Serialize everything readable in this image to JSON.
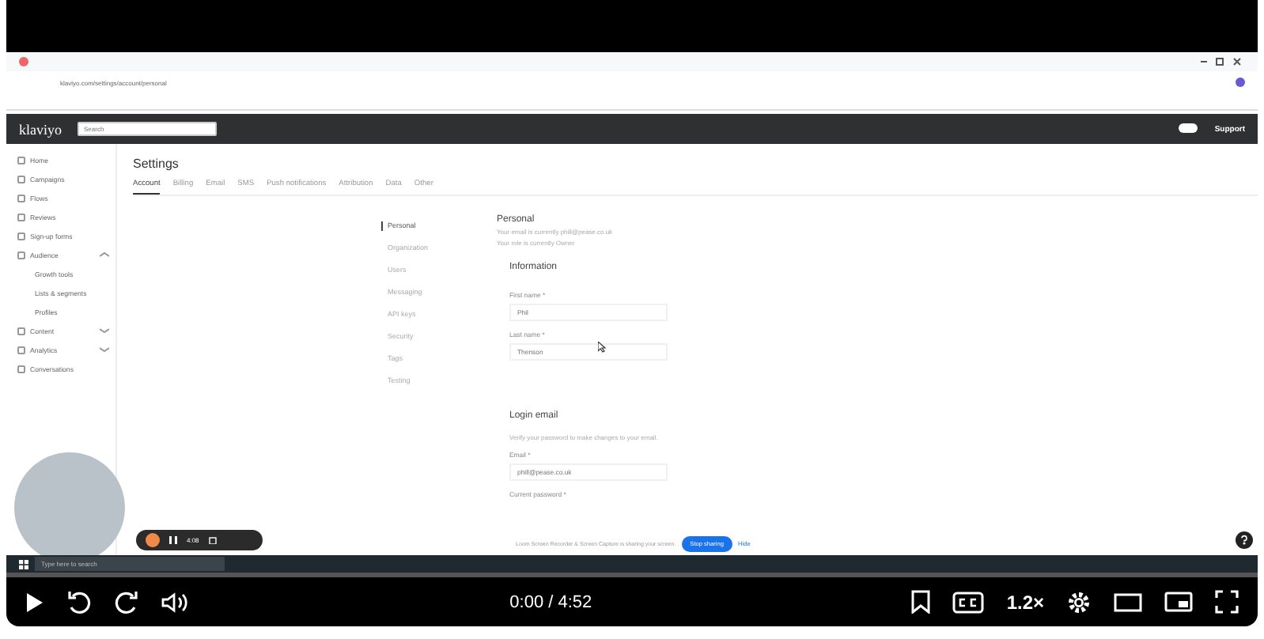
{
  "browser": {
    "url": "klaviyo.com/settings/account/personal"
  },
  "app": {
    "logo": "klaviyo",
    "search_placeholder": "Search",
    "support": "Support"
  },
  "nav": [
    {
      "label": "Home",
      "kind": "link"
    },
    {
      "label": "Campaigns",
      "kind": "link"
    },
    {
      "label": "Flows",
      "kind": "link"
    },
    {
      "label": "Reviews",
      "kind": "link"
    },
    {
      "label": "Sign-up forms",
      "kind": "link"
    },
    {
      "label": "Audience",
      "kind": "group",
      "expanded": true,
      "children": [
        {
          "label": "Growth tools"
        },
        {
          "label": "Lists & segments"
        },
        {
          "label": "Profiles"
        }
      ]
    },
    {
      "label": "Content",
      "kind": "group",
      "expanded": false
    },
    {
      "label": "Analytics",
      "kind": "group",
      "expanded": false
    },
    {
      "label": "Conversations",
      "kind": "link"
    }
  ],
  "page_title": "Settings",
  "tabs": [
    {
      "label": "Account",
      "selected": true
    },
    {
      "label": "Billing",
      "selected": false
    },
    {
      "label": "Email",
      "selected": false
    },
    {
      "label": "SMS",
      "selected": false
    },
    {
      "label": "Push notifications",
      "selected": false
    },
    {
      "label": "Attribution",
      "selected": false
    },
    {
      "label": "Data",
      "selected": false
    },
    {
      "label": "Other",
      "selected": false
    }
  ],
  "subnav": [
    {
      "label": "Personal",
      "selected": true
    },
    {
      "label": "Organization",
      "selected": false
    },
    {
      "label": "Users",
      "selected": false
    },
    {
      "label": "Messaging",
      "selected": false
    },
    {
      "label": "API keys",
      "selected": false
    },
    {
      "label": "Security",
      "selected": false
    },
    {
      "label": "Tags",
      "selected": false
    },
    {
      "label": "Testing",
      "selected": false
    }
  ],
  "personal": {
    "heading": "Personal",
    "lines": [
      "Your email is currently phill@pease.co.uk",
      "Your role is currently Owner"
    ]
  },
  "information": {
    "heading": "Information",
    "fields": [
      {
        "label": "First name *",
        "value": "Phil"
      },
      {
        "label": "Last name *",
        "value": "Thenson"
      }
    ]
  },
  "login_email": {
    "heading": "Login email",
    "hint": "Verify your password to make changes to your email.",
    "fields": [
      {
        "label": "Email *",
        "value": "phill@pease.co.uk"
      }
    ],
    "password_label": "Current password *"
  },
  "share_bar": {
    "text": "Loom Screen Recorder & Screen Capture is sharing your screen.",
    "stop": "Stop sharing",
    "hide": "Hide"
  },
  "recorder": {
    "time": "4:08"
  },
  "taskbar": {
    "search_placeholder": "Type here to search"
  },
  "player": {
    "time": "0:00 / 4:52",
    "speed": "1.2×",
    "level": 0
  }
}
